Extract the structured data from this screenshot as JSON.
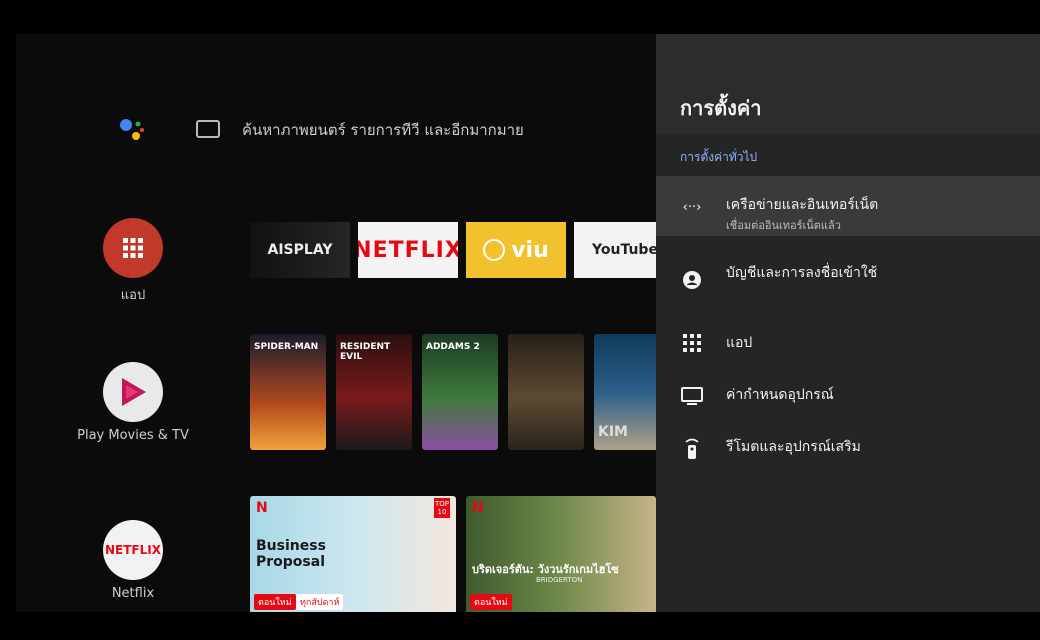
{
  "search": {
    "placeholder_text": "ค้นหาภาพยนตร์ รายการทีวี และอีกมากมาย"
  },
  "rail": {
    "apps_label": "แอป",
    "play_movies_label": "Play Movies & TV",
    "netflix_label": "Netflix",
    "netflix_logo": "NETFLIX"
  },
  "apps_row": [
    "AISPLAY",
    "NETFLIX",
    "viu",
    "YouTube"
  ],
  "posters": [
    "SPIDER-MAN",
    "RESIDENT EVIL",
    "ADDAMS 2",
    "",
    "KIM"
  ],
  "cards": [
    {
      "title": "Business Proposal",
      "badges": [
        "ตอนใหม่",
        "ทุกสัปดาห์"
      ],
      "corner": "TOP 10"
    },
    {
      "title": "บริดเจอร์ตัน: วังวนรักเกมไฮโซ",
      "subtitle": "BRIDGERTON",
      "badges": [
        "ตอนใหม่"
      ]
    }
  ],
  "settings": {
    "title": "การตั้งค่า",
    "section": "การตั้งค่าทั่วไป",
    "items": [
      {
        "title": "เครือข่ายและอินเทอร์เน็ต",
        "subtitle": "เชื่อมต่ออินเทอร์เน็ตแล้ว",
        "icon": "network-icon"
      },
      {
        "title": "บัญชีและการลงชื่อเข้าใช้",
        "subtitle": "",
        "icon": "account-icon"
      },
      {
        "title": "แอป",
        "subtitle": "",
        "icon": "apps-grid-icon"
      },
      {
        "title": "ค่ากำหนดอุปกรณ์",
        "subtitle": "",
        "icon": "tv-icon"
      },
      {
        "title": "รีโมตและอุปกรณ์เสริม",
        "subtitle": "",
        "icon": "remote-icon"
      }
    ]
  },
  "colors": {
    "accent_blue": "#8ab4f8",
    "netflix_red": "#e50914",
    "viu_yellow": "#f2c12e",
    "apps_red": "#c0392b"
  }
}
